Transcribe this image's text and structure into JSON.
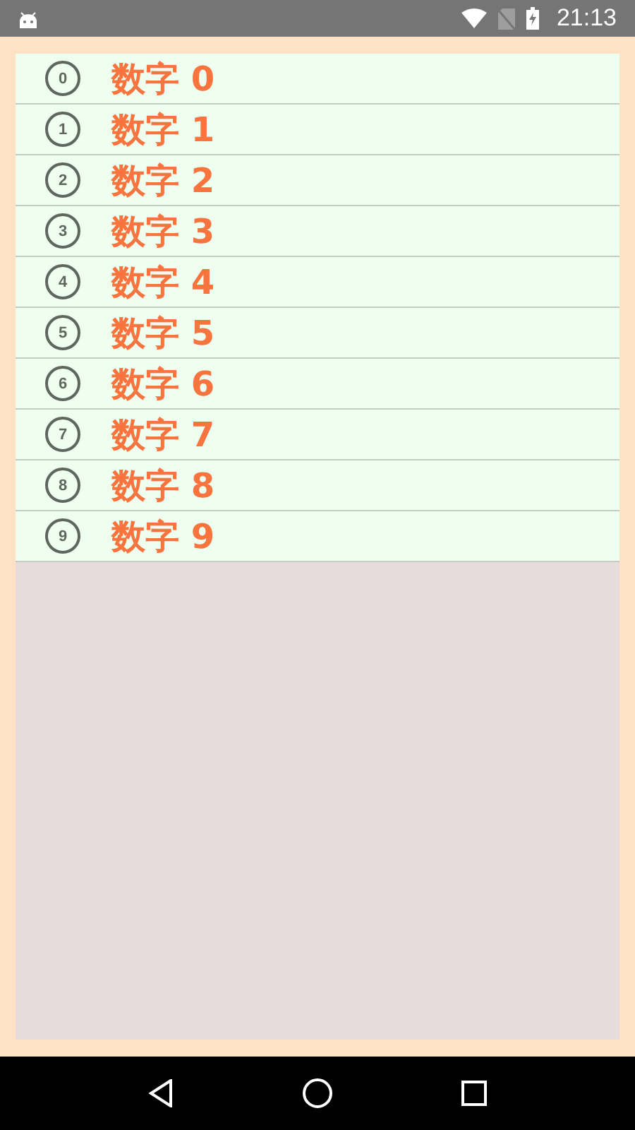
{
  "status_bar": {
    "time": "21:13"
  },
  "list": {
    "items": [
      {
        "number": "0",
        "label": "数字 0"
      },
      {
        "number": "1",
        "label": "数字 1"
      },
      {
        "number": "2",
        "label": "数字 2"
      },
      {
        "number": "3",
        "label": "数字 3"
      },
      {
        "number": "4",
        "label": "数字 4"
      },
      {
        "number": "5",
        "label": "数字 5"
      },
      {
        "number": "6",
        "label": "数字 6"
      },
      {
        "number": "7",
        "label": "数字 7"
      },
      {
        "number": "8",
        "label": "数字 8"
      },
      {
        "number": "9",
        "label": "数字 9"
      }
    ]
  }
}
